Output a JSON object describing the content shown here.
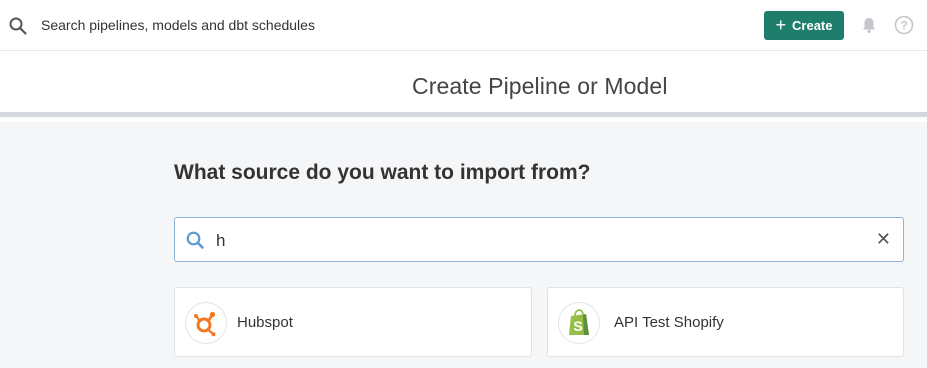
{
  "topbar": {
    "search_placeholder": "Search pipelines, models and dbt schedules",
    "create_label": "Create",
    "create_color": "#1e7d6b",
    "icons": [
      "search-icon",
      "plus-icon",
      "bell-icon",
      "help-icon"
    ]
  },
  "page": {
    "title": "Create Pipeline or Model"
  },
  "main": {
    "question": "What source do you want to import from?",
    "search_value": "h",
    "clear_symbol": "✕",
    "results": [
      {
        "label": "Hubspot",
        "icon": "hubspot-logo-icon",
        "color": "#f57722"
      },
      {
        "label": "API Test Shopify",
        "icon": "shopify-logo-icon",
        "color": "#95bf47"
      }
    ]
  }
}
